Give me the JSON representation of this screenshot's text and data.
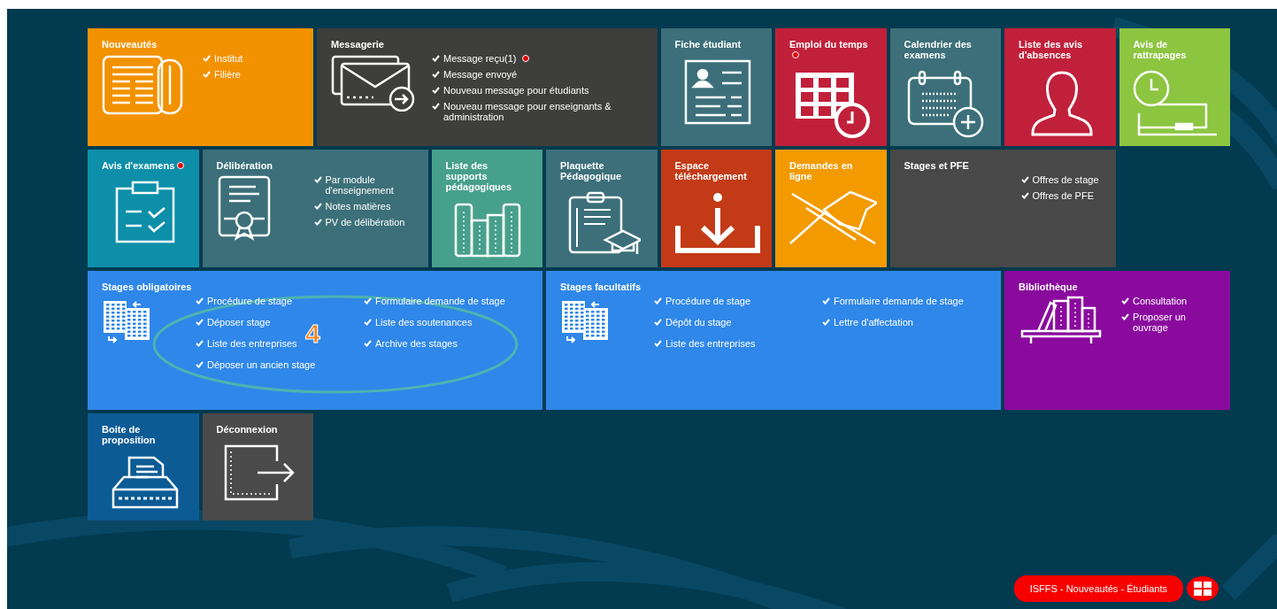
{
  "tiles": [
    {
      "title": "Nouveautés",
      "color": "#f39200",
      "links": [
        {
          "label": "Institut",
          "alert": false
        },
        {
          "label": "Filière",
          "alert": false
        }
      ]
    },
    {
      "title": "Messagerie",
      "color": "#3e3e3c",
      "links": [
        {
          "label": "Message reçu(1)",
          "alert": true
        },
        {
          "label": "Message envoyé",
          "alert": false
        },
        {
          "label": "Nouveau message pour étudiants",
          "alert": false
        },
        {
          "label": "Nouveau message pour enseignants & administration",
          "alert": false
        }
      ]
    },
    {
      "title": "Fiche étudiant",
      "color": "#3c6f79"
    },
    {
      "title": "Emploi du temps",
      "color": "#c1203b",
      "alert": true
    },
    {
      "title": "Calendrier des examens",
      "color": "#3c6f79"
    },
    {
      "title": "Liste des avis d'absences",
      "color": "#c1203b"
    },
    {
      "title": "Avis de rattrapages",
      "color": "#8cc540"
    },
    {
      "title": "Avis d'examens",
      "color": "#0d8fa9",
      "alert": true
    },
    {
      "title": "Délibération",
      "color": "#3c6f79",
      "links": [
        {
          "label": "Par module d'enseignement",
          "alert": false
        },
        {
          "label": "Notes matières",
          "alert": false
        },
        {
          "label": "PV de délibération",
          "alert": false
        }
      ]
    },
    {
      "title": "Liste des supports pédagogiques",
      "color": "#47a08c"
    },
    {
      "title": "Plaquette Pédagogique",
      "color": "#3c6f79"
    },
    {
      "title": "Espace téléchargement",
      "color": "#c23b16"
    },
    {
      "title": "Demandes en ligne",
      "color": "#f39a00"
    },
    {
      "title": "Stages et PFE",
      "color": "#484848",
      "links": [
        {
          "label": "Offres de stage",
          "alert": false
        },
        {
          "label": "Offres de PFE",
          "alert": false
        }
      ]
    },
    {
      "title": "Stages obligatoires",
      "color": "#2f87e9",
      "links": [
        {
          "label": "Procédure de stage",
          "alert": false
        },
        {
          "label": "Formulaire demande de stage",
          "alert": false
        },
        {
          "label": "Déposer stage",
          "alert": false
        },
        {
          "label": "Liste des soutenances",
          "alert": false
        },
        {
          "label": "Liste des entreprises",
          "alert": false
        },
        {
          "label": "Archive des stages",
          "alert": false
        },
        {
          "label": "Déposer un ancien stage",
          "alert": false
        }
      ]
    },
    {
      "title": "Stages facultatifs",
      "color": "#2f87e9",
      "links": [
        {
          "label": "Procédure de stage",
          "alert": false
        },
        {
          "label": "Formulaire demande de stage",
          "alert": false
        },
        {
          "label": "Dépôt du stage",
          "alert": false
        },
        {
          "label": "Lettre d'affectation",
          "alert": false
        },
        {
          "label": "Liste des entreprises",
          "alert": false
        }
      ]
    },
    {
      "title": "Bibliothèque",
      "color": "#8a0a9e",
      "links": [
        {
          "label": "Consultation",
          "alert": false
        },
        {
          "label": "Proposer un ouvrage",
          "alert": false
        }
      ]
    },
    {
      "title": "Boite de proposition",
      "color": "#0d5b95"
    },
    {
      "title": "Déconnexion",
      "color": "#4a4a4a"
    }
  ],
  "annotation": {
    "label": "4"
  },
  "footer": {
    "label": "ISFFS - Nouveautés - Étudiants"
  }
}
